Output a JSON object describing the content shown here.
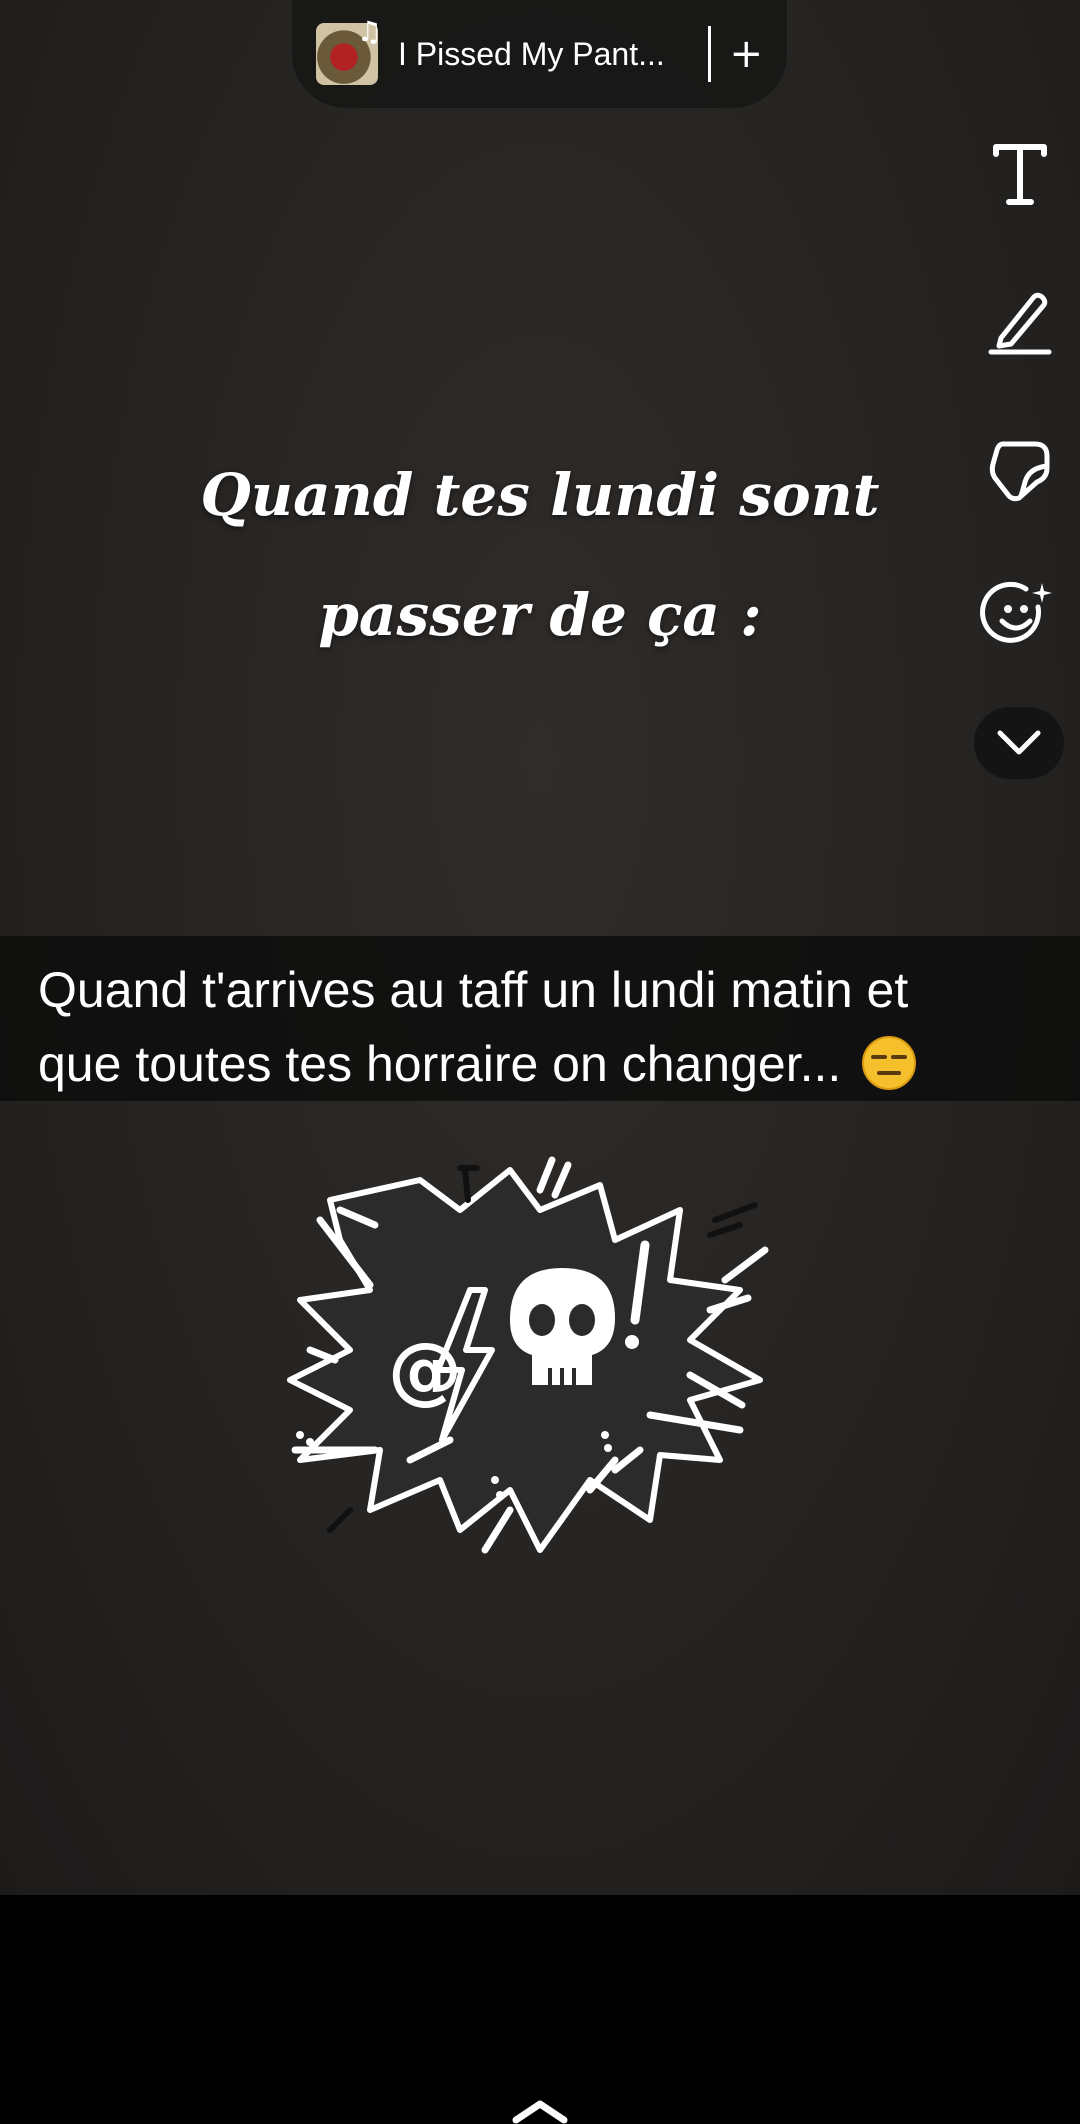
{
  "music": {
    "song_title": "I Pissed My Pant...",
    "add_symbol": "+"
  },
  "toolbar": {
    "items": [
      {
        "name": "text-tool",
        "icon": "text-t-icon"
      },
      {
        "name": "draw-tool",
        "icon": "pencil-icon"
      },
      {
        "name": "sticker-tool",
        "icon": "sticker-icon"
      },
      {
        "name": "emoji-tool",
        "icon": "smiley-sparkle-icon"
      },
      {
        "name": "collapse-toggle",
        "icon": "chevron-down-icon"
      }
    ]
  },
  "headline": {
    "line1": "Quand tes lundi sont",
    "line2": "passer de ça  :"
  },
  "caption": {
    "line1": "Quand t'arrives au taff un lundi matin et",
    "line2": "que toutes tes horraire on changer...",
    "emoji": "expressionless-face"
  },
  "sticker": {
    "icon": "angry-burst-skull-sticker",
    "symbols": [
      "@",
      "!"
    ]
  },
  "colors": {
    "background": "#262422",
    "text": "#ffffff",
    "caption_bg": "#0c0c0c",
    "emoji": "#f5c02c"
  }
}
